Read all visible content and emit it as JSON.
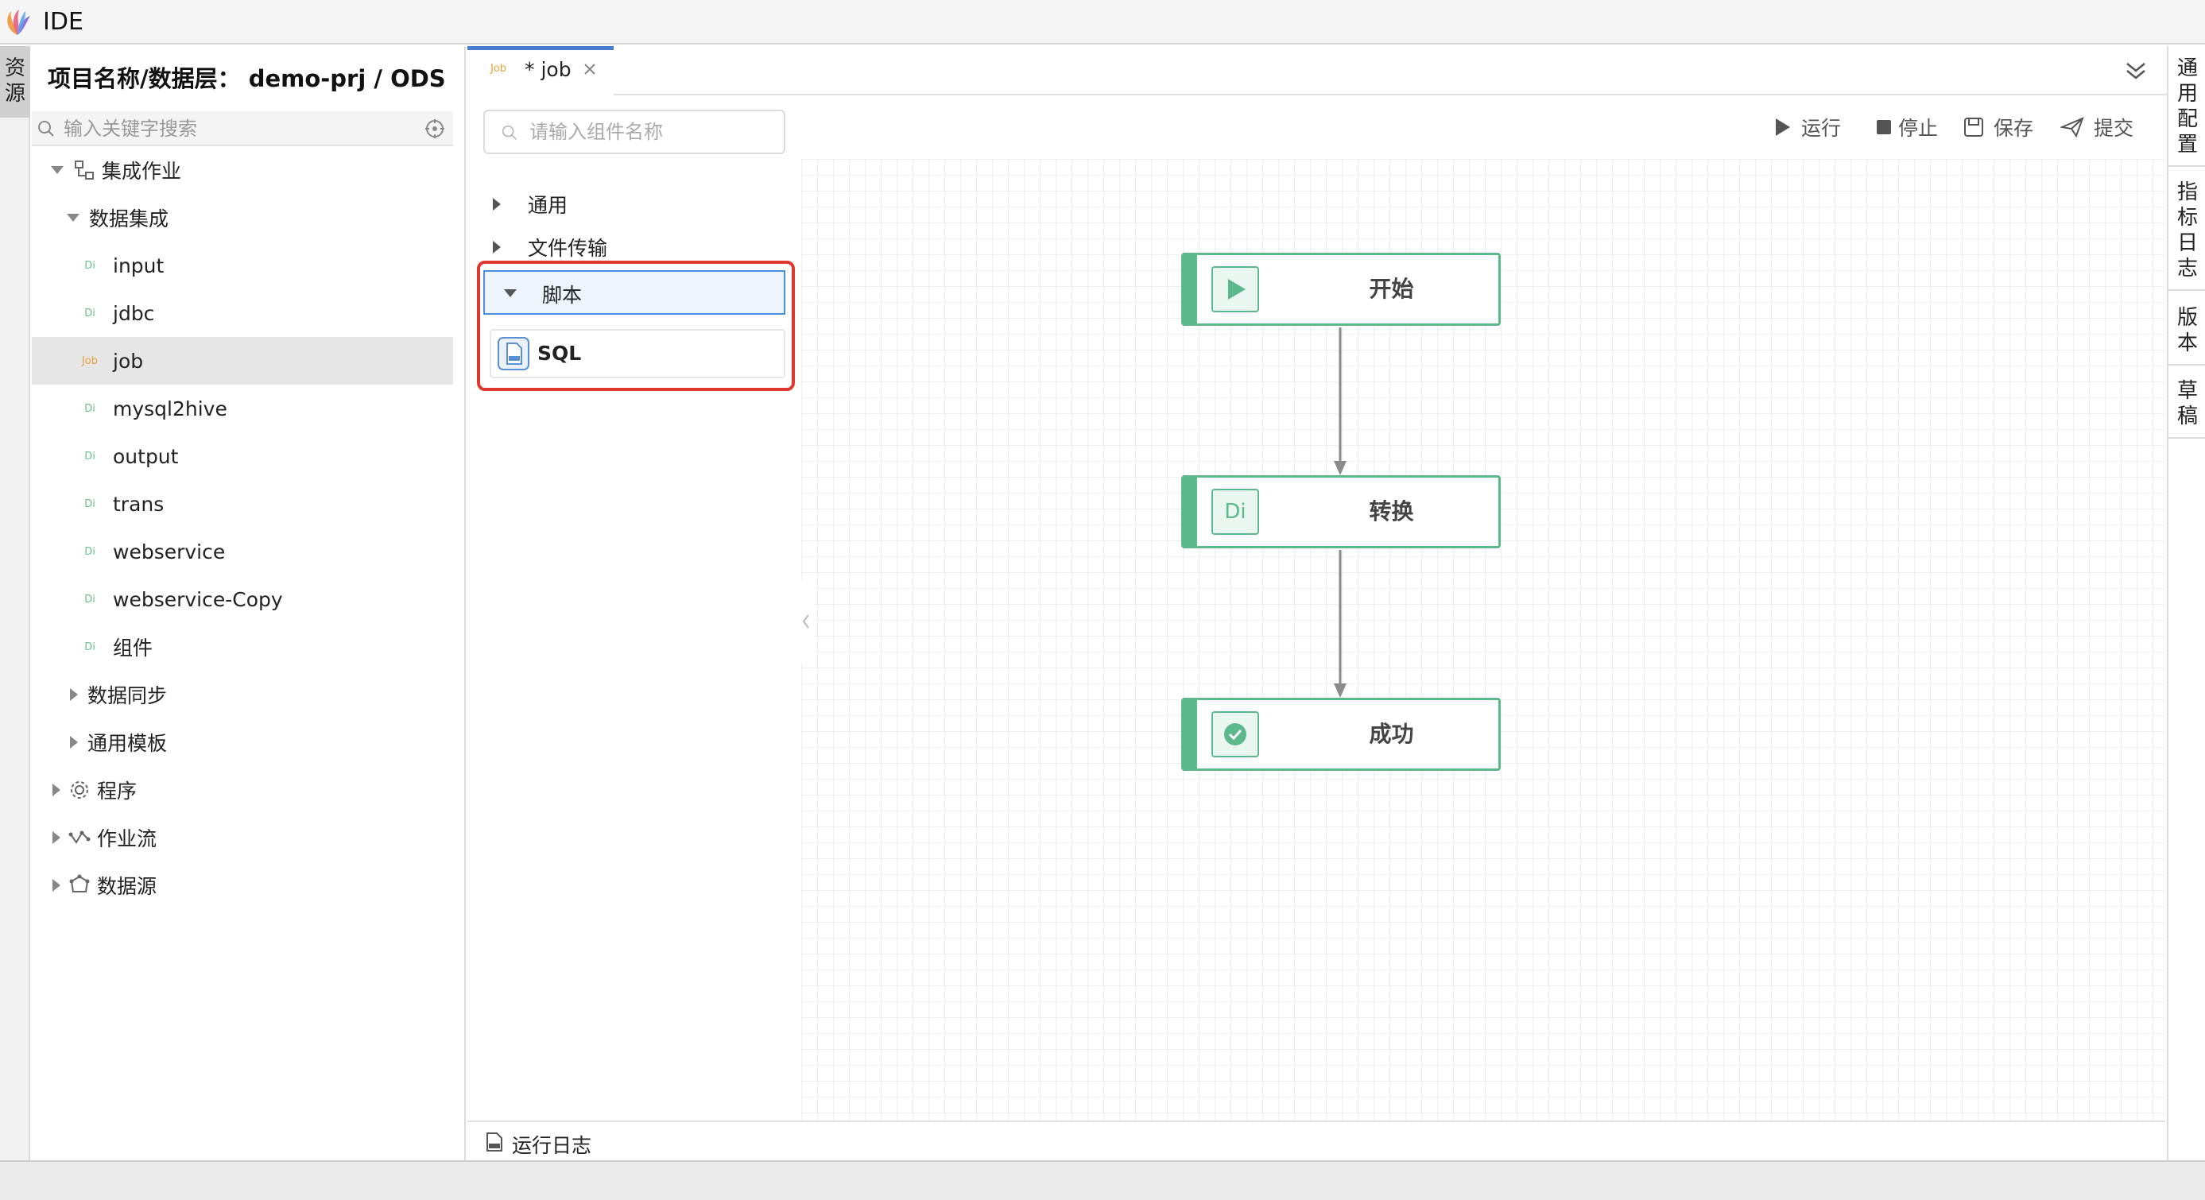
{
  "app": {
    "title": "IDE"
  },
  "left_strip": {
    "label_1": "资",
    "label_2": "源"
  },
  "resource": {
    "project_title": "项目名称/数据层： demo-prj / ODS",
    "search_placeholder": "输入关键字搜索",
    "tree": {
      "integration_job": "集成作业",
      "data_integration": "数据集成",
      "files": [
        "input",
        "jdbc",
        "job",
        "mysql2hive",
        "output",
        "trans",
        "webservice",
        "webservice-Copy",
        "组件"
      ],
      "data_sync": "数据同步",
      "common_template": "通用模板",
      "program": "程序",
      "workflow": "作业流",
      "datasource": "数据源"
    },
    "badge_di": "Di",
    "badge_job": "Job"
  },
  "tab": {
    "badge": "Job",
    "label": "* job"
  },
  "components": {
    "search_placeholder": "请输入组件名称",
    "categories": {
      "common": "通用",
      "file_transfer": "文件传输",
      "script": "脚本"
    },
    "sql_item": "SQL"
  },
  "toolbar": {
    "run": "运行",
    "stop": "停止",
    "save": "保存",
    "submit": "提交"
  },
  "flow": {
    "start": "开始",
    "transform": "转换",
    "transform_icon_text": "Di",
    "success": "成功"
  },
  "right_strip": {
    "general_config": [
      "通",
      "用",
      "配",
      "置"
    ],
    "metrics_log": [
      "指",
      "标",
      "日",
      "志"
    ],
    "version": [
      "版",
      "本"
    ],
    "draft": [
      "草",
      "稿"
    ]
  },
  "log": {
    "label": "运行日志"
  },
  "colors": {
    "accent_green": "#5bb98c",
    "highlight_red": "#e0382f",
    "tab_blue": "#4a7cd1"
  }
}
